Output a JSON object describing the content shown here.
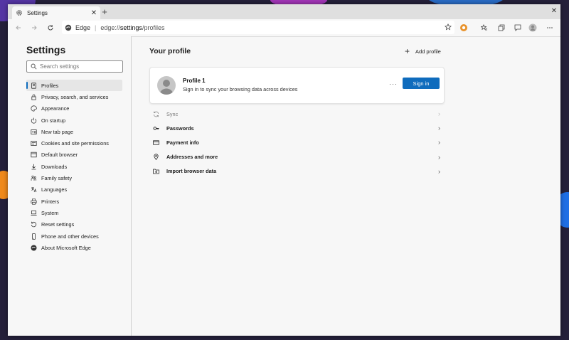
{
  "tab": {
    "title": "Settings"
  },
  "omnibox": {
    "site": "Edge",
    "url_prefix": "edge://",
    "url_host": "settings",
    "url_path": "/profiles"
  },
  "sidebar": {
    "title": "Settings",
    "search_placeholder": "Search settings",
    "items": [
      {
        "label": "Profiles",
        "icon": "person-icon",
        "active": true
      },
      {
        "label": "Privacy, search, and services",
        "icon": "lock-icon"
      },
      {
        "label": "Appearance",
        "icon": "palette-icon"
      },
      {
        "label": "On startup",
        "icon": "power-icon"
      },
      {
        "label": "New tab page",
        "icon": "newtab-icon"
      },
      {
        "label": "Cookies and site permissions",
        "icon": "permissions-icon"
      },
      {
        "label": "Default browser",
        "icon": "browser-icon"
      },
      {
        "label": "Downloads",
        "icon": "download-icon"
      },
      {
        "label": "Family safety",
        "icon": "family-icon"
      },
      {
        "label": "Languages",
        "icon": "language-icon"
      },
      {
        "label": "Printers",
        "icon": "printer-icon"
      },
      {
        "label": "System",
        "icon": "system-icon"
      },
      {
        "label": "Reset settings",
        "icon": "reset-icon"
      },
      {
        "label": "Phone and other devices",
        "icon": "phone-icon"
      },
      {
        "label": "About Microsoft Edge",
        "icon": "edge-icon"
      }
    ]
  },
  "main": {
    "title": "Your profile",
    "add_profile": "Add profile",
    "profile": {
      "name": "Profile 1",
      "subtitle": "Sign in to sync your browsing data across devices",
      "more": "···",
      "signin_label": "Sign in"
    },
    "rows": [
      {
        "label": "Sync",
        "icon": "sync-icon",
        "disabled": true
      },
      {
        "label": "Passwords",
        "icon": "key-icon"
      },
      {
        "label": "Payment info",
        "icon": "card-icon"
      },
      {
        "label": "Addresses and more",
        "icon": "location-icon"
      },
      {
        "label": "Import browser data",
        "icon": "import-icon"
      }
    ]
  },
  "colors": {
    "accent": "#0f6cbd",
    "background": "#f7f7f7"
  }
}
